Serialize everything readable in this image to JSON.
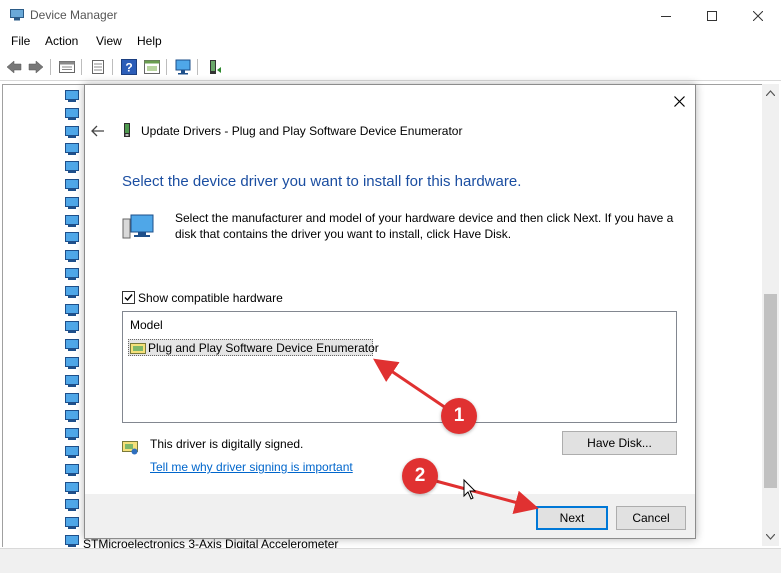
{
  "window": {
    "title": "Device Manager",
    "controls": [
      "minimize",
      "maximize",
      "close"
    ]
  },
  "menu": {
    "items": [
      {
        "label": "File"
      },
      {
        "label": "Action"
      },
      {
        "label": "View"
      },
      {
        "label": "Help"
      }
    ]
  },
  "toolbar": {
    "icons": [
      "back-arrow-icon",
      "forward-arrow-icon",
      "properties-icon",
      "details-icon",
      "help-icon",
      "action-icon",
      "scan-hardware-icon",
      "update-driver-icon"
    ]
  },
  "tree": {
    "visible_label": "STMicroelectronics 3-Axis Digital Accelerometer",
    "icon": "computer-monitor-icon"
  },
  "dialog": {
    "title": "Update Drivers - Plug and Play Software Device Enumerator",
    "heading": "Select the device driver you want to install for this hardware.",
    "description": "Select the manufacturer and model of your hardware device and then click Next. If you have a disk that contains the driver you want to install, click Have Disk.",
    "show_compatible_label": "Show compatible hardware",
    "show_compatible_checked": true,
    "list_header": "Model",
    "models": [
      {
        "label": "Plug and Play Software Device Enumerator",
        "selected": true
      }
    ],
    "signed_text": "This driver is digitally signed.",
    "signing_link": "Tell me why driver signing is important",
    "have_disk_label": "Have Disk...",
    "next_label": "Next",
    "cancel_label": "Cancel"
  },
  "annotations": {
    "badge_1": "1",
    "badge_2": "2",
    "color": "#e03131"
  },
  "colors": {
    "heading": "#1b4ea1",
    "link": "#0066cc",
    "focus": "#0078d7"
  }
}
